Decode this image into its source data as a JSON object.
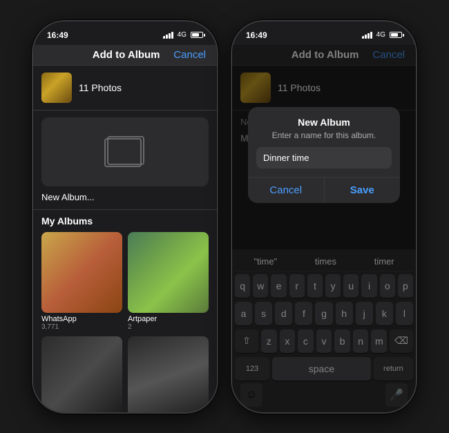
{
  "phones": {
    "left": {
      "status_time": "16:49",
      "status_signal": "4G",
      "nav_title": "Add to Album",
      "nav_cancel": "Cancel",
      "photos_count": "11 Photos",
      "new_album_label": "New Album...",
      "section_title": "My Albums",
      "albums": [
        {
          "name": "WhatsApp",
          "count": "3,771"
        },
        {
          "name": "Artpaper",
          "count": "2"
        },
        {
          "name": "",
          "count": ""
        },
        {
          "name": "",
          "count": ""
        }
      ]
    },
    "right": {
      "status_time": "16:49",
      "status_signal": "4G",
      "nav_title": "Add to Album",
      "nav_cancel": "Cancel",
      "photos_count": "11 Photos",
      "new_album_label": "New Album...",
      "section_title": "My Albums",
      "dialog": {
        "title": "New Album",
        "subtitle": "Enter a name for this album.",
        "input_value": "Dinner time",
        "cancel_label": "Cancel",
        "save_label": "Save"
      },
      "keyboard": {
        "autocorrect": [
          "“time”",
          "times",
          "timer"
        ],
        "rows": [
          [
            "q",
            "w",
            "e",
            "r",
            "t",
            "y",
            "u",
            "i",
            "o",
            "p"
          ],
          [
            "a",
            "s",
            "d",
            "f",
            "g",
            "h",
            "j",
            "k",
            "l"
          ],
          [
            "z",
            "x",
            "c",
            "v",
            "b",
            "n",
            "m"
          ],
          [
            "123",
            "space",
            "return"
          ]
        ]
      }
    }
  }
}
